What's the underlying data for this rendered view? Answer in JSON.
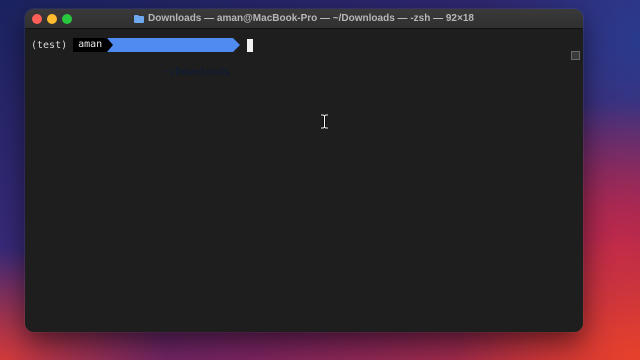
{
  "window": {
    "title": "Downloads — aman@MacBook-Pro — ~/Downloads — -zsh — 92×18",
    "title_icon": "folder-icon"
  },
  "terminal": {
    "venv": "(test)",
    "user": "aman",
    "directory": "~/Downloads"
  },
  "colors": {
    "background": "#1e1e1e",
    "prompt_dir_segment": "#4f8bf0",
    "prompt_user_segment": "#000000",
    "close": "#ff5f57",
    "minimize": "#febc2e",
    "maximize": "#28c840"
  }
}
